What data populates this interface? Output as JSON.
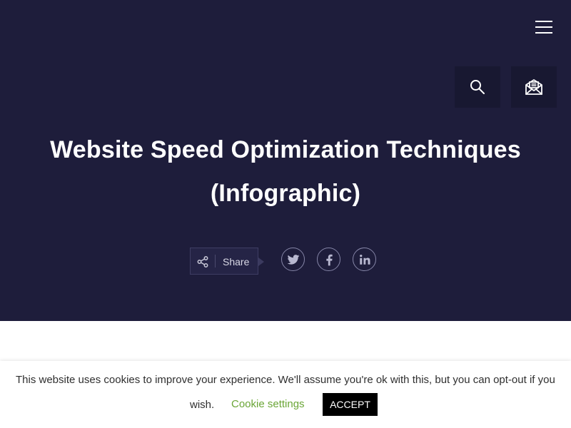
{
  "header": {
    "menu_icon": "hamburger-icon",
    "search_icon": "search-icon",
    "subscribe_icon": "newsletter-envelope-icon"
  },
  "post": {
    "title": "Website Speed Optimization Techniques (Infographic)"
  },
  "share": {
    "label": "Share",
    "icon": "share-icon",
    "social": [
      {
        "name": "twitter",
        "icon": "twitter-icon"
      },
      {
        "name": "facebook",
        "icon": "facebook-icon"
      },
      {
        "name": "linkedin",
        "icon": "linkedin-icon"
      }
    ]
  },
  "cookie_notice": {
    "text": "This website uses cookies to improve your experience. We'll assume you're ok with this, but you can opt-out if you",
    "text_continued": "wish.",
    "settings_link": "Cookie settings",
    "accept_label": "ACCEPT"
  },
  "colors": {
    "hero_background": "#1e1d3b",
    "tool_button_background": "#181831",
    "cookie_link": "#6aa536",
    "accept_button_background": "#000000"
  }
}
